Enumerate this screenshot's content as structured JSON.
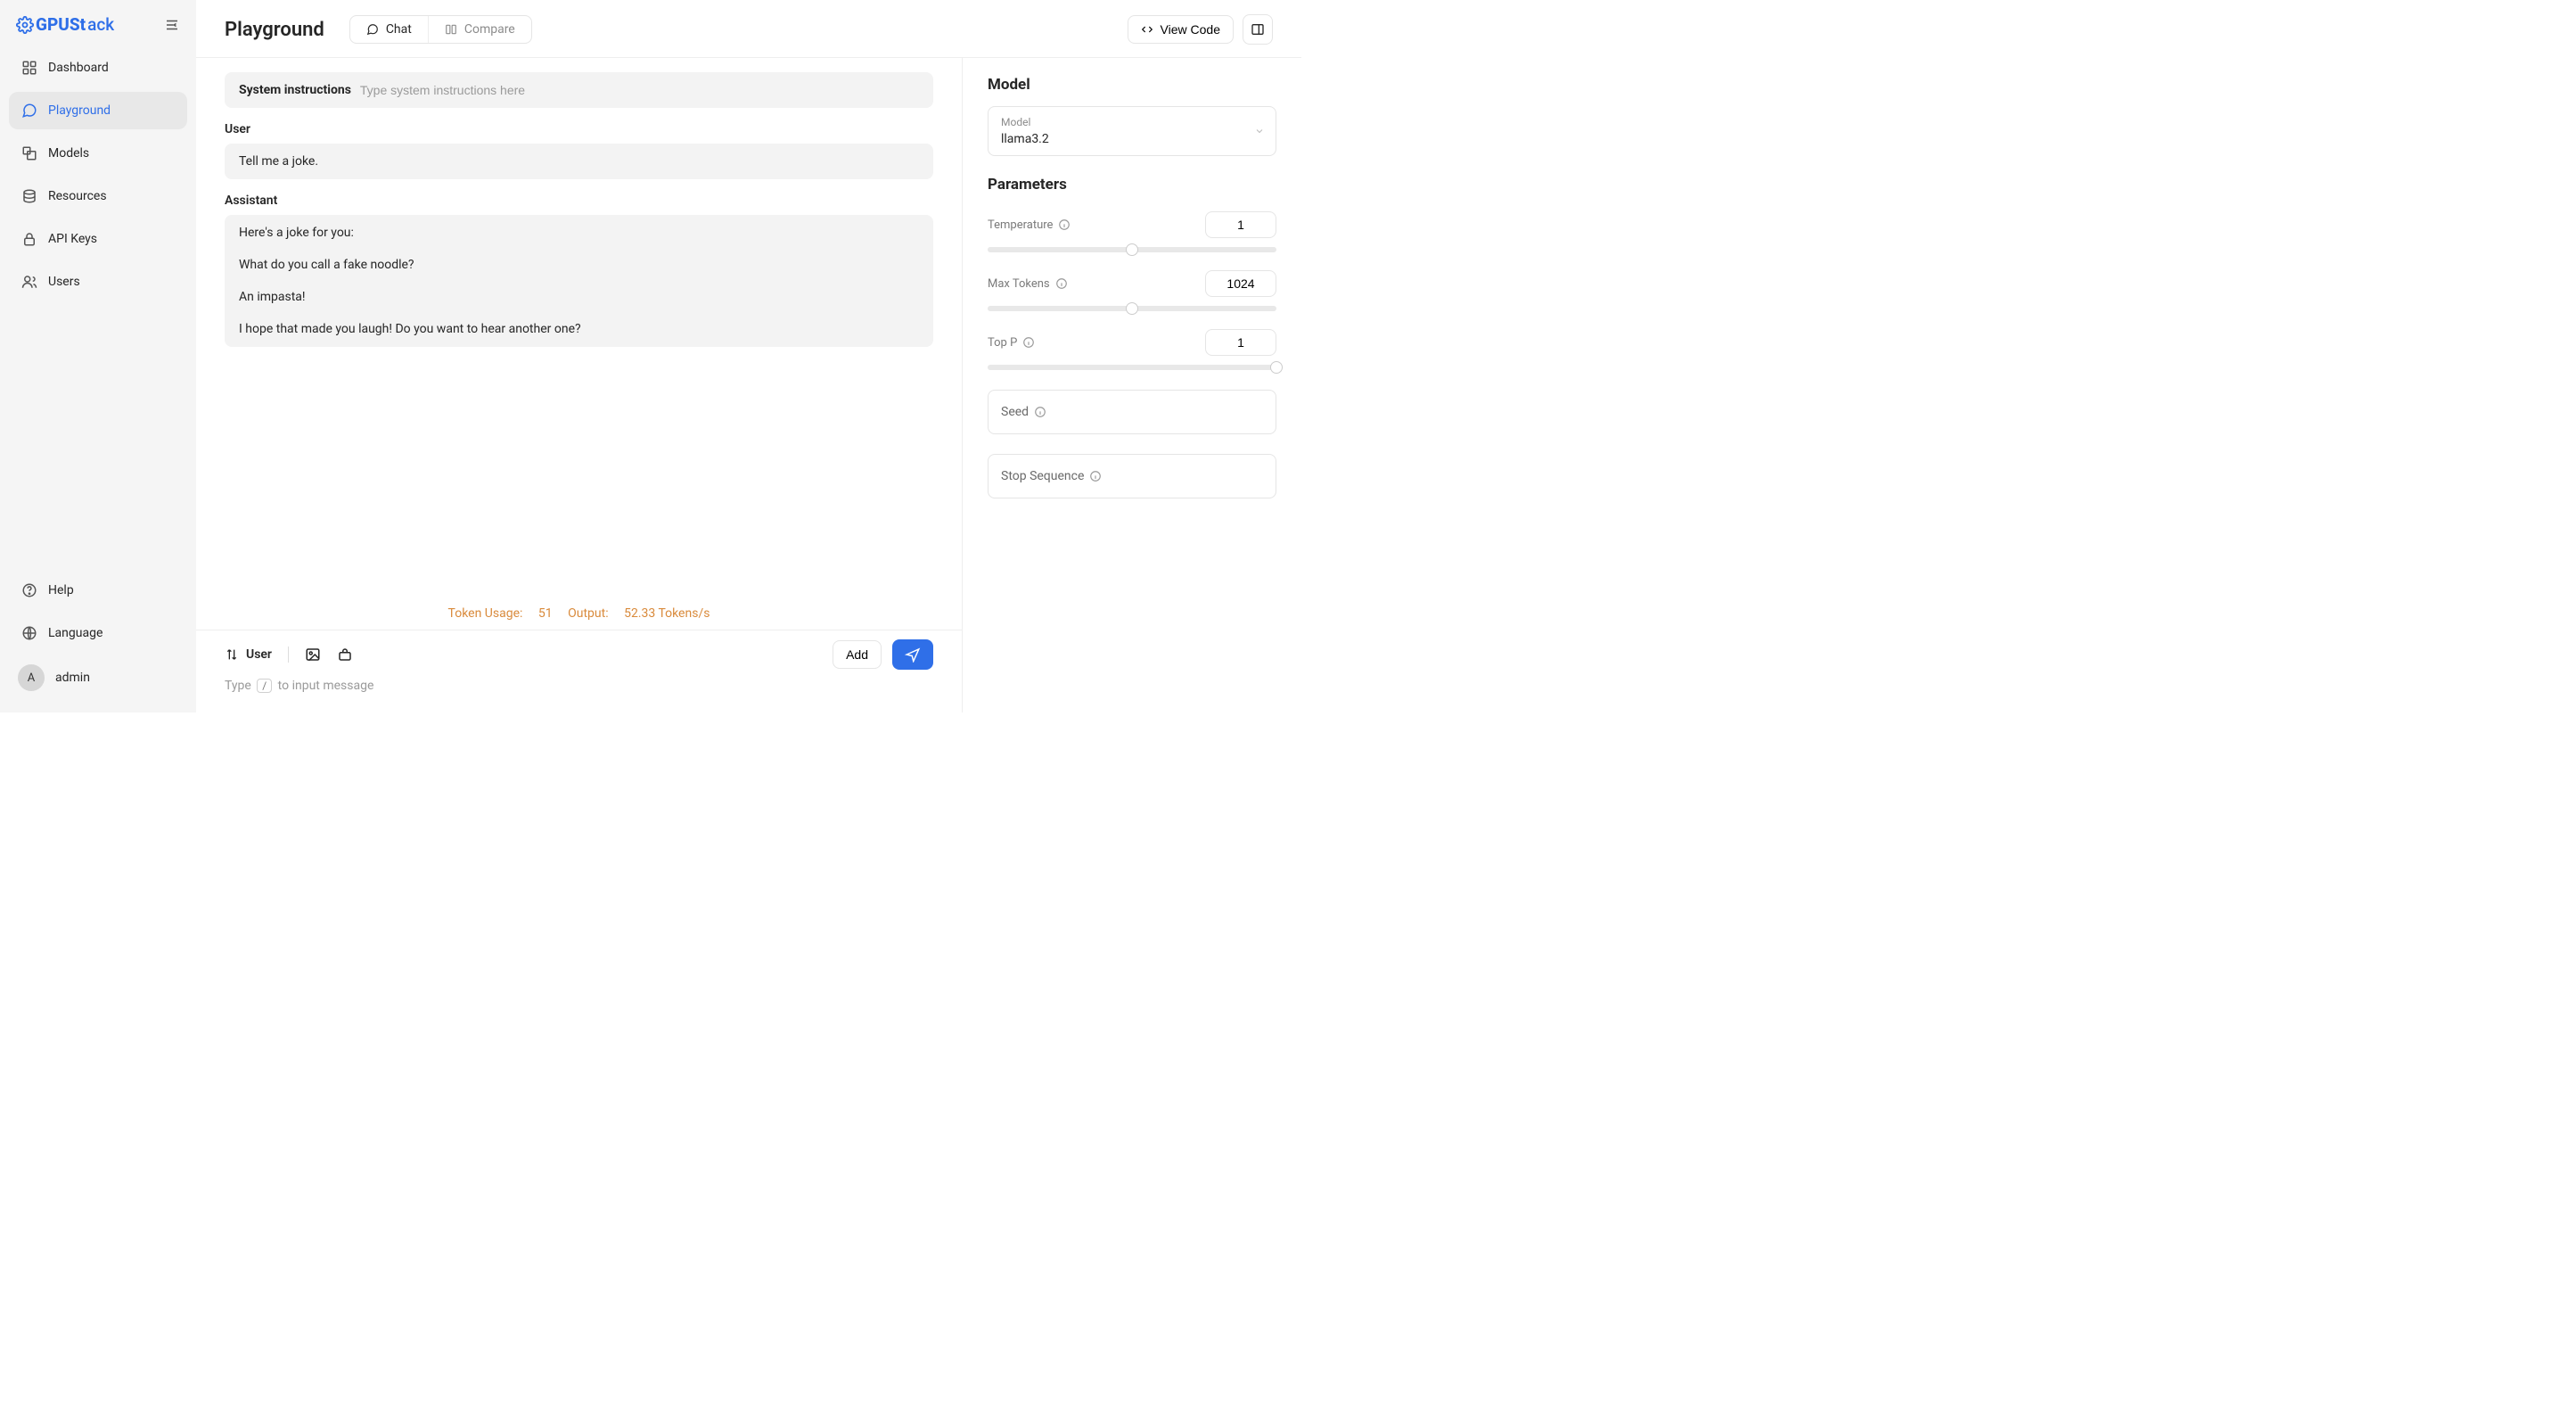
{
  "brand": {
    "name": "GPUStack",
    "gpu": "GPUSt",
    "stack": "ack"
  },
  "sidebar": {
    "items": [
      {
        "label": "Dashboard"
      },
      {
        "label": "Playground"
      },
      {
        "label": "Models"
      },
      {
        "label": "Resources"
      },
      {
        "label": "API Keys"
      },
      {
        "label": "Users"
      }
    ],
    "footer": {
      "help": "Help",
      "language": "Language",
      "user_initial": "A",
      "user_name": "admin"
    }
  },
  "header": {
    "title": "Playground",
    "mode": {
      "chat": "Chat",
      "compare": "Compare"
    },
    "view_code": "View Code"
  },
  "conversation": {
    "system_label": "System instructions",
    "system_placeholder": "Type system instructions here",
    "user_role": "User",
    "user_message": "Tell me a joke.",
    "assistant_role": "Assistant",
    "assistant_lines": [
      "Here's a joke for you:",
      "What do you call a fake noodle?",
      "An impasta!",
      "I hope that made you laugh! Do you want to hear another one?"
    ]
  },
  "metrics": {
    "token_usage_label": "Token Usage:",
    "token_usage_value": "51",
    "output_label": "Output:",
    "output_value": "52.33 Tokens/s"
  },
  "composer": {
    "role": "User",
    "add": "Add",
    "hint_prefix": "Type ",
    "hint_key": "/",
    "hint_suffix": " to input message"
  },
  "panel": {
    "model_heading": "Model",
    "model_select_label": "Model",
    "model_value": "llama3.2",
    "parameters_heading": "Parameters",
    "temperature": {
      "label": "Temperature",
      "value": "1",
      "percent": 50
    },
    "max_tokens": {
      "label": "Max Tokens",
      "value": "1024",
      "percent": 50
    },
    "top_p": {
      "label": "Top P",
      "value": "1",
      "percent": 100
    },
    "seed_label": "Seed",
    "stop_sequence_label": "Stop Sequence"
  }
}
